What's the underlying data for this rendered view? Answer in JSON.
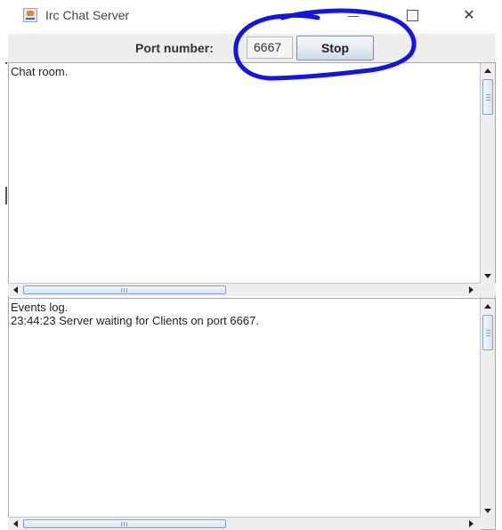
{
  "window": {
    "title": "Irc Chat Server",
    "icon": "java-app-icon",
    "controls": [
      "minimize-icon",
      "maximize-icon",
      "close-icon"
    ]
  },
  "toolbar": {
    "port_label": "Port number:",
    "port_value": "6667",
    "stop_label": "Stop"
  },
  "chat_room": {
    "text": "Chat room."
  },
  "events_log": {
    "text": "Events log.\n23:44:23 Server waiting for Clients on port 6667."
  },
  "annotation": {
    "color": "#1414e6",
    "shape": "hand-drawn-circle"
  },
  "colors": {
    "scroll_thumb_border": "#8aa0ba",
    "button_border": "#7c8fa6"
  }
}
